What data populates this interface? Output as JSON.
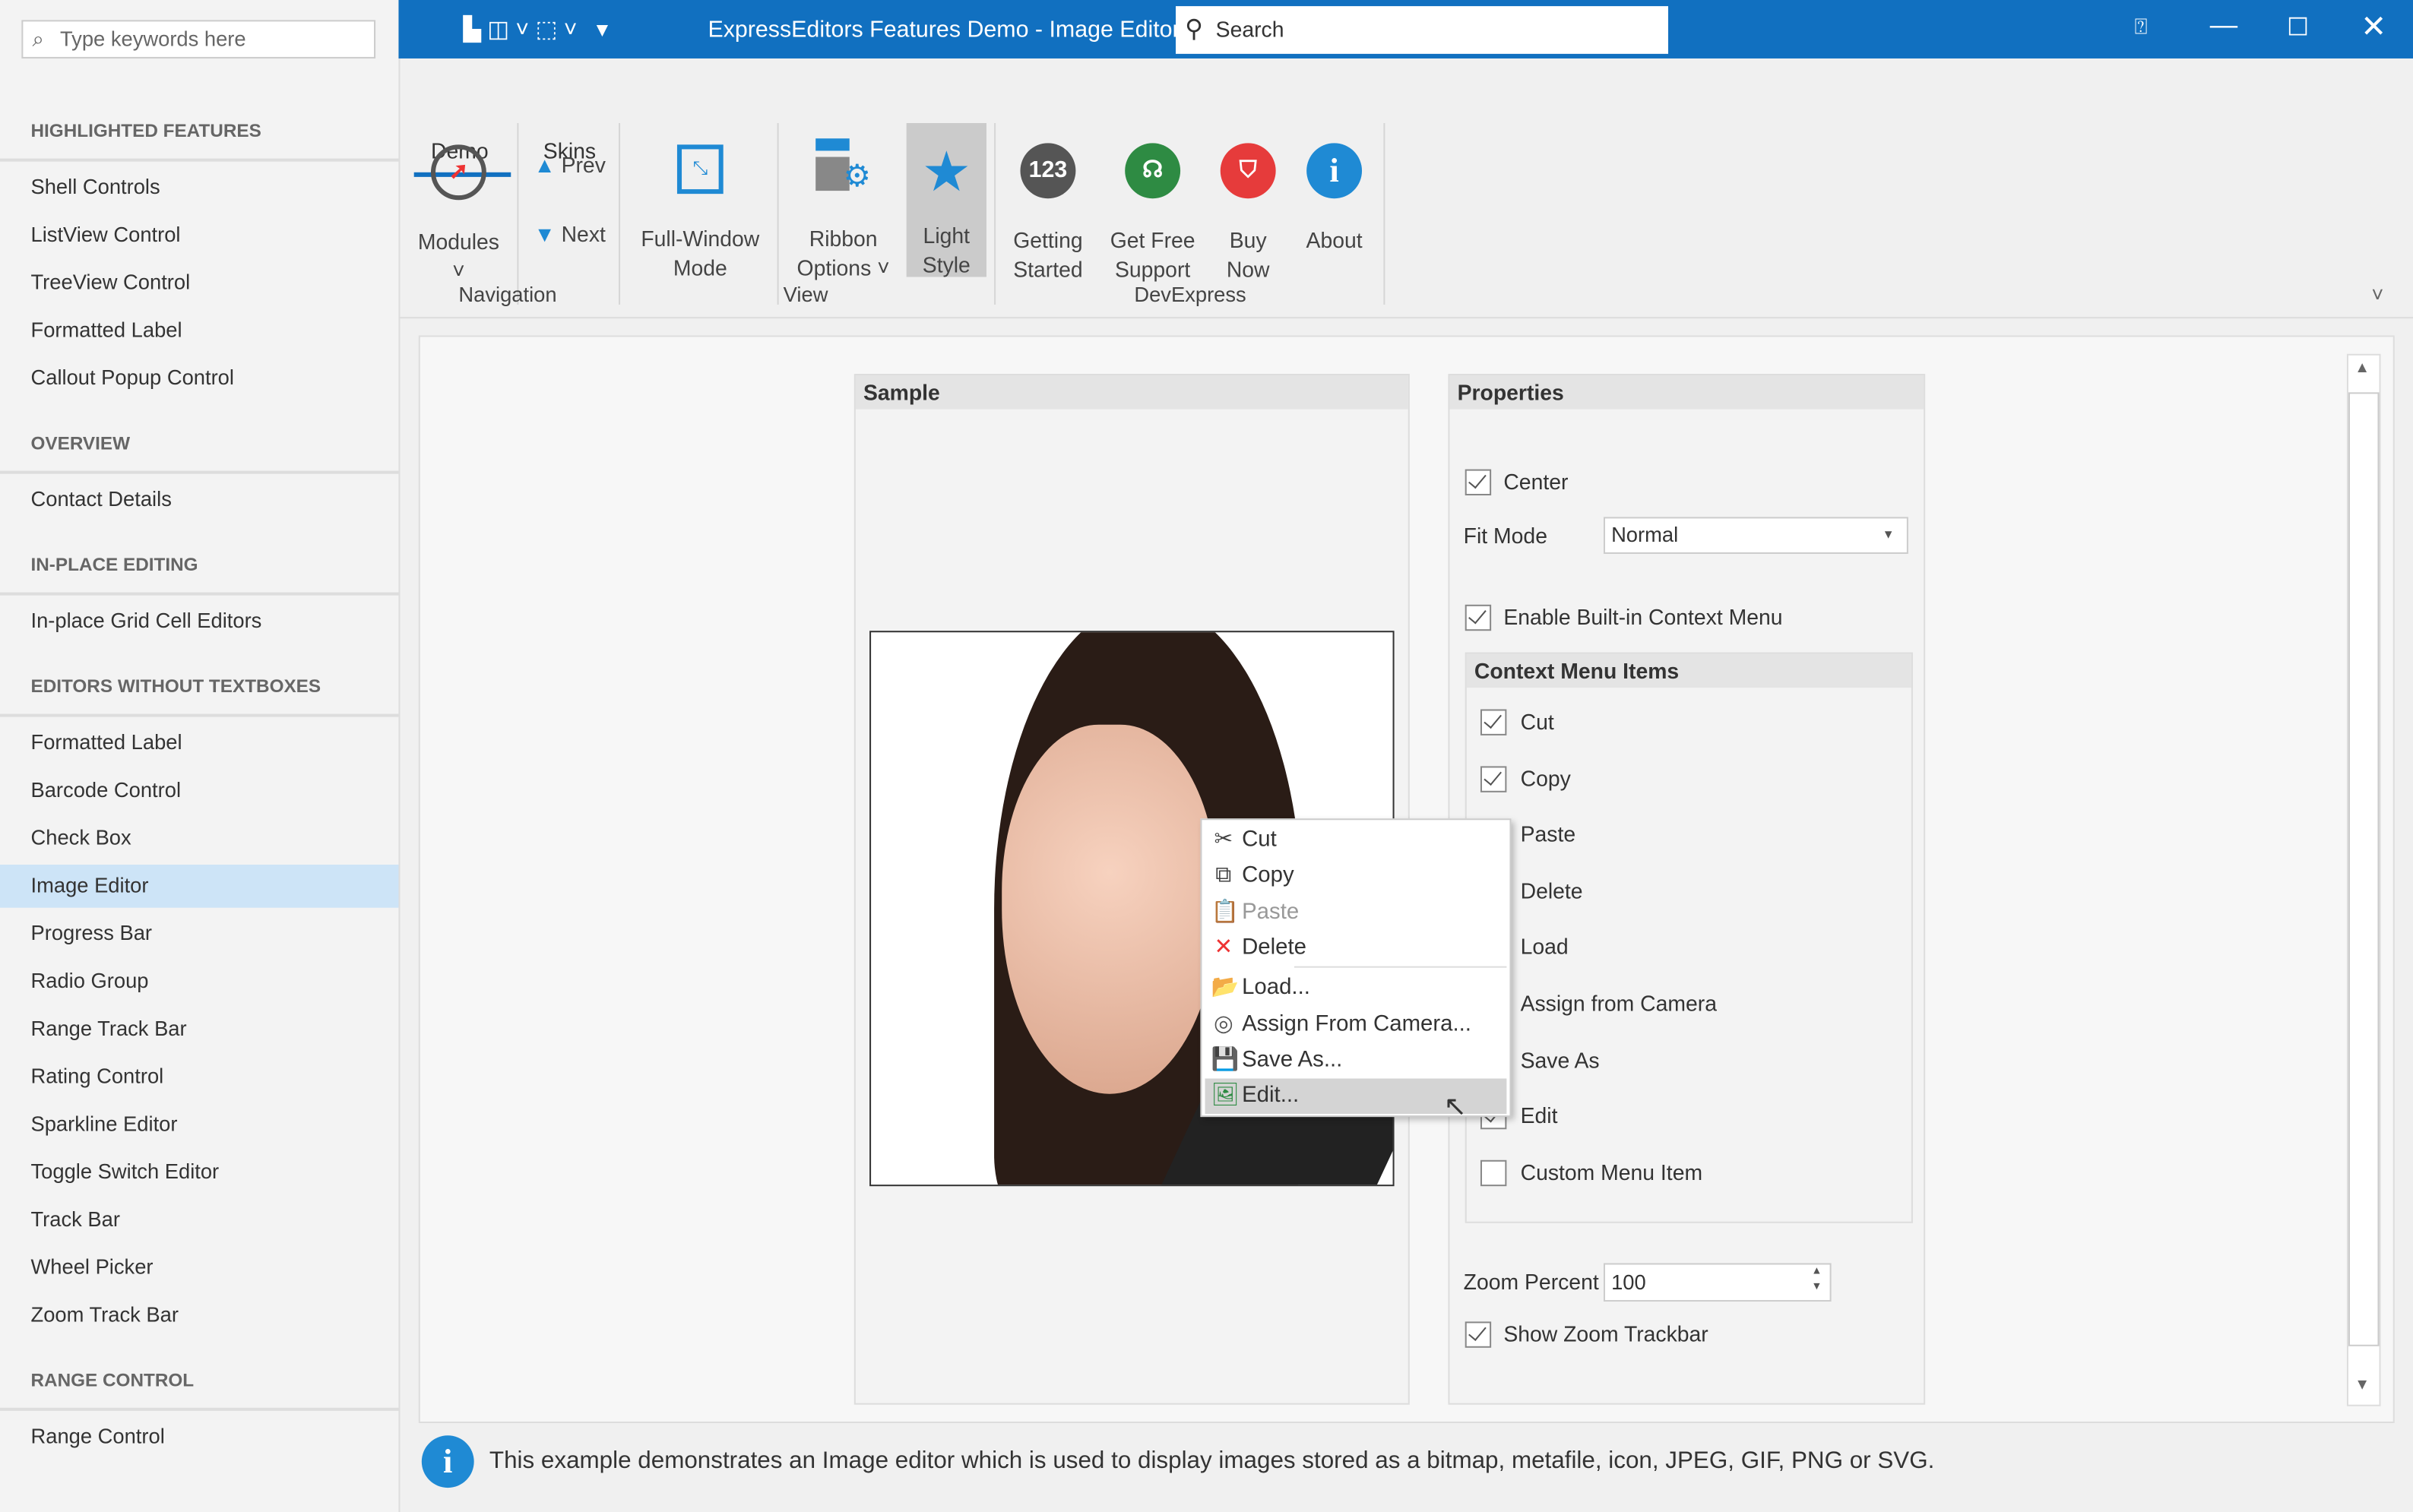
{
  "sidebar": {
    "search_placeholder": "Type keywords here",
    "sections": [
      {
        "title": "HIGHLIGHTED FEATURES",
        "items": [
          "Shell Controls",
          "ListView Control",
          "TreeView Control",
          "Formatted Label",
          "Callout Popup Control"
        ]
      },
      {
        "title": "OVERVIEW",
        "items": [
          "Contact Details"
        ]
      },
      {
        "title": "IN-PLACE EDITING",
        "items": [
          "In-place Grid Cell Editors"
        ]
      },
      {
        "title": "EDITORS WITHOUT TEXTBOXES",
        "items": [
          "Formatted Label",
          "Barcode Control",
          "Check Box",
          "Image Editor",
          "Progress Bar",
          "Radio Group",
          "Range Track Bar",
          "Rating Control",
          "Sparkline Editor",
          "Toggle Switch Editor",
          "Track Bar",
          "Wheel Picker",
          "Zoom Track Bar"
        ]
      },
      {
        "title": "RANGE CONTROL",
        "items": [
          "Range Control"
        ]
      }
    ],
    "selected": "Image Editor"
  },
  "titlebar": {
    "title": "ExpressEditors Features Demo -  Image Editor",
    "search": "Search"
  },
  "ribbon": {
    "tabs": [
      "Demo",
      "Skins"
    ],
    "active_tab": "Demo",
    "buttons": {
      "modules": "Modules",
      "prev": "Prev",
      "next": "Next",
      "full1": "Full-Window",
      "full2": "Mode",
      "ro1": "Ribbon",
      "ro2": "Options",
      "ls1": "Light",
      "ls2": "Style",
      "gs1": "Getting",
      "gs2": "Started",
      "gf1": "Get Free",
      "gf2": "Support",
      "bn1": "Buy",
      "bn2": "Now",
      "about": "About",
      "num": "123"
    },
    "groups": {
      "nav": "Navigation",
      "view": "View",
      "dx": "DevExpress"
    }
  },
  "sample": {
    "title": "Sample"
  },
  "properties": {
    "title": "Properties",
    "center": "Center",
    "center_checked": true,
    "fit_mode_label": "Fit Mode",
    "fit_mode": "Normal",
    "enable_menu": "Enable Built-in Context Menu",
    "enable_menu_checked": true,
    "cmi_title": "Context Menu Items",
    "items": [
      {
        "label": "Cut",
        "checked": true
      },
      {
        "label": "Copy",
        "checked": true
      },
      {
        "label": "Paste",
        "checked": true
      },
      {
        "label": "Delete",
        "checked": true
      },
      {
        "label": "Load",
        "checked": true
      },
      {
        "label": "Assign from Camera",
        "checked": true
      },
      {
        "label": "Save As",
        "checked": true
      },
      {
        "label": "Edit",
        "checked": true
      },
      {
        "label": "Custom Menu Item",
        "checked": false
      }
    ],
    "zoom_label": "Zoom Percent",
    "zoom": "100",
    "show_trackbar": "Show Zoom Trackbar",
    "show_trackbar_checked": true
  },
  "context_menu": [
    "Cut",
    "Copy",
    "Paste",
    "Delete",
    "Load...",
    "Assign From Camera...",
    "Save As...",
    "Edit..."
  ],
  "context_menu_disabled": [
    "Paste"
  ],
  "context_menu_hovered": "Edit...",
  "info": "This example demonstrates an Image editor which is used to display images stored as a bitmap, metafile, icon, JPEG, GIF, PNG or SVG.",
  "colors": {
    "accent": "#1170c0",
    "selected": "#cde4f7"
  }
}
